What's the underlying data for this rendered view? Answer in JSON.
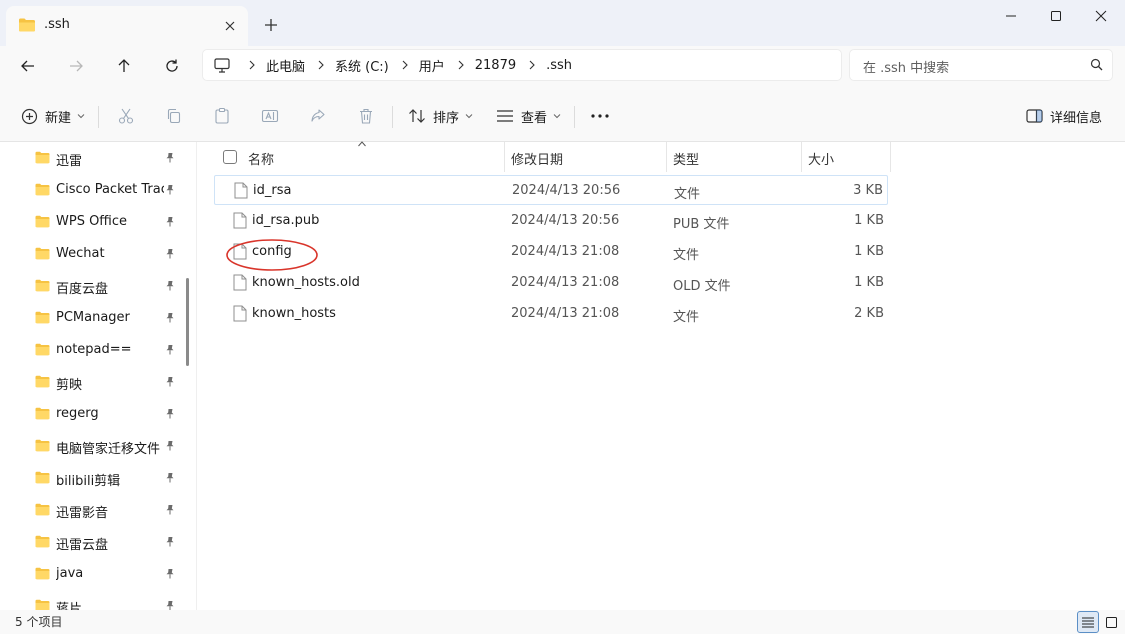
{
  "window": {
    "tab_title": ".ssh",
    "new_tab_symbol": "+",
    "controls": [
      "minimize",
      "maximize",
      "close"
    ]
  },
  "address": {
    "breadcrumb": [
      "此电脑",
      "系统 (C:)",
      "用户",
      "21879",
      ".ssh"
    ],
    "search_placeholder": "在 .ssh 中搜索"
  },
  "toolbar": {
    "new_label": "新建",
    "sort_label": "排序",
    "view_label": "查看",
    "more_label": "···",
    "details_label": "详细信息",
    "icons": [
      "cut-icon",
      "copy-icon",
      "paste-icon",
      "rename-icon",
      "share-icon",
      "delete-icon"
    ]
  },
  "sidebar": {
    "items": [
      {
        "label": "迅雷"
      },
      {
        "label": "Cisco Packet Tracer"
      },
      {
        "label": "WPS Office"
      },
      {
        "label": "Wechat"
      },
      {
        "label": "百度云盘"
      },
      {
        "label": "PCManager"
      },
      {
        "label": "notepad=="
      },
      {
        "label": "剪映"
      },
      {
        "label": "regerg"
      },
      {
        "label": "电脑管家迁移文件"
      },
      {
        "label": "bilibili剪辑"
      },
      {
        "label": "迅雷影音"
      },
      {
        "label": "迅雷云盘"
      },
      {
        "label": "java"
      },
      {
        "label": "蒋片"
      }
    ]
  },
  "filelist": {
    "columns": {
      "name": "名称",
      "modified": "修改日期",
      "type": "类型",
      "size": "大小"
    },
    "files": [
      {
        "name": "id_rsa",
        "modified": "2024/4/13 20:56",
        "type": "文件",
        "size": "3 KB",
        "selected": true
      },
      {
        "name": "id_rsa.pub",
        "modified": "2024/4/13 20:56",
        "type": "PUB 文件",
        "size": "1 KB"
      },
      {
        "name": "config",
        "modified": "2024/4/13 21:08",
        "type": "文件",
        "size": "1 KB",
        "circled": true
      },
      {
        "name": "known_hosts.old",
        "modified": "2024/4/13 21:08",
        "type": "OLD 文件",
        "size": "1 KB"
      },
      {
        "name": "known_hosts",
        "modified": "2024/4/13 21:08",
        "type": "文件",
        "size": "2 KB"
      }
    ],
    "annotation_color": "#d9352b"
  },
  "status": {
    "item_count": "5 个项目"
  },
  "colors": {
    "folder_yellow": "#f6c343",
    "accent_blue": "#3b7fd1",
    "selected_border": "#cfe3f7"
  }
}
